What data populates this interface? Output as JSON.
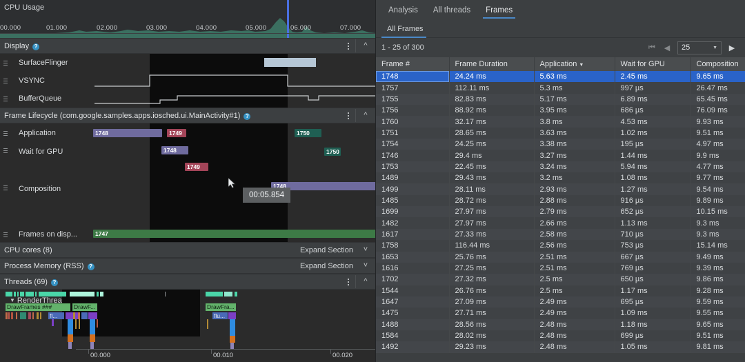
{
  "left_panel": {
    "cpu_usage": {
      "title": "CPU Usage",
      "ticks": [
        "00.000",
        "01.000",
        "02.000",
        "03.000",
        "04.000",
        "05.000",
        "06.000",
        "07.000"
      ],
      "marker_color": "#4a6fe0",
      "area_color": "#3e7a68"
    },
    "sections": [
      {
        "id": "display",
        "title": "Display",
        "has_help": true,
        "collapse_icon": "chevron-up-icon",
        "menu_icon": "kebab-menu-icon",
        "tracks": [
          "SurfaceFlinger",
          "VSYNC",
          "BufferQueue"
        ]
      },
      {
        "id": "frame-lifecycle",
        "title": "Frame Lifecycle (com.google.samples.apps.iosched.ui.MainActivity#1)",
        "has_help": true,
        "collapse_icon": "chevron-up-icon",
        "menu_icon": "kebab-menu-icon",
        "tracks": [
          "Application",
          "Wait for GPU",
          "Composition",
          "Frames on disp..."
        ]
      },
      {
        "id": "cpu-cores",
        "title": "CPU cores (8)",
        "has_help": false,
        "action_label": "Expand Section",
        "collapse_icon": "chevron-down-icon"
      },
      {
        "id": "process-memory",
        "title": "Process Memory (RSS)",
        "has_help": true,
        "action_label": "Expand Section",
        "collapse_icon": "chevron-down-icon"
      },
      {
        "id": "threads",
        "title": "Threads (69)",
        "has_help": true,
        "collapse_icon": "chevron-up-icon",
        "menu_icon": "kebab-menu-icon"
      }
    ],
    "frame_bars": {
      "application": [
        {
          "label": "1748",
          "color": "purple"
        },
        {
          "label": "1749",
          "color": "red"
        },
        {
          "label": "1750",
          "color": "teal"
        }
      ],
      "wait_for_gpu": [
        {
          "label": "1748",
          "color": "purple"
        },
        {
          "label": "1749",
          "color": "red"
        },
        {
          "label": "1750",
          "color": "teal"
        }
      ],
      "composition": [
        {
          "label": "1748",
          "color": "purple"
        }
      ],
      "frames_on_display": [
        {
          "label": "1747",
          "color": "green"
        }
      ]
    },
    "tooltip": {
      "text": "00:05.854"
    },
    "threads": {
      "expand_icon": "triangle-down-icon",
      "name": "RenderThread",
      "slices": [
        "DrawFrames ###",
        "DrawF...",
        "fl...",
        "DrawFra...",
        "flu..."
      ]
    },
    "bottom_ruler": {
      "ticks": [
        "00.000",
        "00.010",
        "00.020"
      ]
    }
  },
  "right_panel": {
    "tabs": [
      {
        "label": "Analysis",
        "active": false
      },
      {
        "label": "All threads",
        "active": false
      },
      {
        "label": "Frames",
        "active": true
      }
    ],
    "subtabs": [
      {
        "label": "All Frames",
        "active": true
      }
    ],
    "pager": {
      "range_text": "1 - 25 of 300",
      "first_icon": "first-page-icon",
      "prev_icon": "previous-page-icon",
      "next_icon": "next-page-icon",
      "page_size": "25",
      "dropdown_icon": "chevron-down-icon"
    },
    "table": {
      "columns": [
        {
          "label": "Frame #",
          "sorted": false
        },
        {
          "label": "Frame Duration",
          "sorted": false
        },
        {
          "label": "Application",
          "sorted": true,
          "sort_icon": "sort-descending-icon"
        },
        {
          "label": "Wait for GPU",
          "sorted": false
        },
        {
          "label": "Composition",
          "sorted": false
        }
      ],
      "rows": [
        {
          "frame": "1748",
          "duration": "24.24 ms",
          "application": "5.63 ms",
          "wait": "2.45 ms",
          "composition": "9.65 ms",
          "selected": true
        },
        {
          "frame": "1757",
          "duration": "112.11 ms",
          "application": "5.3 ms",
          "wait": "997 µs",
          "composition": "26.47 ms"
        },
        {
          "frame": "1755",
          "duration": "82.83 ms",
          "application": "5.17 ms",
          "wait": "6.89 ms",
          "composition": "65.45 ms"
        },
        {
          "frame": "1756",
          "duration": "88.92 ms",
          "application": "3.95 ms",
          "wait": "686 µs",
          "composition": "76.09 ms"
        },
        {
          "frame": "1760",
          "duration": "32.17 ms",
          "application": "3.8 ms",
          "wait": "4.53 ms",
          "composition": "9.93 ms"
        },
        {
          "frame": "1751",
          "duration": "28.65 ms",
          "application": "3.63 ms",
          "wait": "1.02 ms",
          "composition": "9.51 ms"
        },
        {
          "frame": "1754",
          "duration": "24.25 ms",
          "application": "3.38 ms",
          "wait": "195 µs",
          "composition": "4.97 ms"
        },
        {
          "frame": "1746",
          "duration": "29.4 ms",
          "application": "3.27 ms",
          "wait": "1.44 ms",
          "composition": "9.9 ms"
        },
        {
          "frame": "1753",
          "duration": "22.45 ms",
          "application": "3.24 ms",
          "wait": "5.94 ms",
          "composition": "4.77 ms"
        },
        {
          "frame": "1489",
          "duration": "29.43 ms",
          "application": "3.2 ms",
          "wait": "1.08 ms",
          "composition": "9.77 ms"
        },
        {
          "frame": "1499",
          "duration": "28.11 ms",
          "application": "2.93 ms",
          "wait": "1.27 ms",
          "composition": "9.54 ms"
        },
        {
          "frame": "1485",
          "duration": "28.72 ms",
          "application": "2.88 ms",
          "wait": "916 µs",
          "composition": "9.89 ms"
        },
        {
          "frame": "1699",
          "duration": "27.97 ms",
          "application": "2.79 ms",
          "wait": "652 µs",
          "composition": "10.15 ms"
        },
        {
          "frame": "1482",
          "duration": "27.97 ms",
          "application": "2.66 ms",
          "wait": "1.13 ms",
          "composition": "9.3 ms"
        },
        {
          "frame": "1617",
          "duration": "27.33 ms",
          "application": "2.58 ms",
          "wait": "710 µs",
          "composition": "9.3 ms"
        },
        {
          "frame": "1758",
          "duration": "116.44 ms",
          "application": "2.56 ms",
          "wait": "753 µs",
          "composition": "15.14 ms"
        },
        {
          "frame": "1653",
          "duration": "25.76 ms",
          "application": "2.51 ms",
          "wait": "667 µs",
          "composition": "9.49 ms"
        },
        {
          "frame": "1616",
          "duration": "27.25 ms",
          "application": "2.51 ms",
          "wait": "769 µs",
          "composition": "9.39 ms"
        },
        {
          "frame": "1702",
          "duration": "27.32 ms",
          "application": "2.5 ms",
          "wait": "650 µs",
          "composition": "9.86 ms"
        },
        {
          "frame": "1544",
          "duration": "26.76 ms",
          "application": "2.5 ms",
          "wait": "1.17 ms",
          "composition": "9.28 ms"
        },
        {
          "frame": "1647",
          "duration": "27.09 ms",
          "application": "2.49 ms",
          "wait": "695 µs",
          "composition": "9.59 ms"
        },
        {
          "frame": "1475",
          "duration": "27.71 ms",
          "application": "2.49 ms",
          "wait": "1.09 ms",
          "composition": "9.55 ms"
        },
        {
          "frame": "1488",
          "duration": "28.56 ms",
          "application": "2.48 ms",
          "wait": "1.18 ms",
          "composition": "9.65 ms"
        },
        {
          "frame": "1584",
          "duration": "28.02 ms",
          "application": "2.48 ms",
          "wait": "699 µs",
          "composition": "9.51 ms"
        },
        {
          "frame": "1492",
          "duration": "29.23 ms",
          "application": "2.48 ms",
          "wait": "1.05 ms",
          "composition": "9.81 ms"
        }
      ]
    }
  }
}
